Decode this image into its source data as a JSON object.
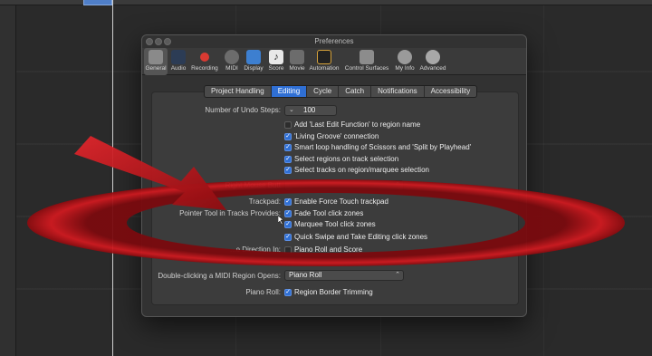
{
  "window": {
    "title": "Preferences"
  },
  "toolbar": {
    "items": [
      {
        "label": "General",
        "icon": "general-icon",
        "color": "#8a8a8a"
      },
      {
        "label": "Audio",
        "icon": "audio-icon",
        "color": "#5a7fb5"
      },
      {
        "label": "Recording",
        "icon": "record-icon",
        "color": "#d93a32"
      },
      {
        "label": "MIDI",
        "icon": "midi-icon",
        "color": "#7a7a7a"
      },
      {
        "label": "Display",
        "icon": "display-icon",
        "color": "#3d7fd0"
      },
      {
        "label": "Score",
        "icon": "score-icon",
        "color": "#e8e8e8"
      },
      {
        "label": "Movie",
        "icon": "movie-icon",
        "color": "#6c6c6c"
      },
      {
        "label": "Automation",
        "icon": "automation-icon",
        "color": "#2c2c2c"
      },
      {
        "label": "Control Surfaces",
        "icon": "control-surfaces-icon",
        "color": "#8c8c8c"
      },
      {
        "label": "My Info",
        "icon": "my-info-icon",
        "color": "#9a9a9a"
      },
      {
        "label": "Advanced",
        "icon": "advanced-icon",
        "color": "#a8a8a8"
      }
    ],
    "selected": "General"
  },
  "tabs": [
    "Project Handling",
    "Editing",
    "Cycle",
    "Catch",
    "Notifications",
    "Accessibility"
  ],
  "active_tab": "Editing",
  "undo": {
    "label": "Number of Undo Steps:",
    "value": "100"
  },
  "checks_top": [
    {
      "label": "Add 'Last Edit Function' to region name",
      "checked": false
    },
    {
      "label": "'Living Groove' connection",
      "checked": true
    },
    {
      "label": "Smart loop handling of Scissors and 'Split by Playhead'",
      "checked": true
    },
    {
      "label": "Select regions on track selection",
      "checked": true
    },
    {
      "label": "Select tracks on region/marquee selection",
      "checked": true
    }
  ],
  "right_mouse": {
    "label": "Right Mouse Butt"
  },
  "trackpad": {
    "label": "Trackpad:",
    "option": "Enable Force Touch trackpad",
    "checked": true
  },
  "pointer_tool": {
    "label": "Pointer Tool in Tracks Provides:",
    "options": [
      {
        "label": "Fade Tool click zones",
        "checked": true
      },
      {
        "label": "Marquee Tool click zones",
        "checked": true
      },
      {
        "label": "Quick Swipe and Take Editing click zones",
        "checked": true
      }
    ]
  },
  "one_direction": {
    "label": "...e Direction In:",
    "option": "Piano Roll and Score",
    "checked": false
  },
  "midi_region": {
    "label": "Double-clicking a MIDI Region Opens:",
    "value": "Piano Roll"
  },
  "piano_roll": {
    "label": "Piano Roll:",
    "option": "Region Border Trimming",
    "checked": true
  },
  "overlay_color": "#c0141a"
}
